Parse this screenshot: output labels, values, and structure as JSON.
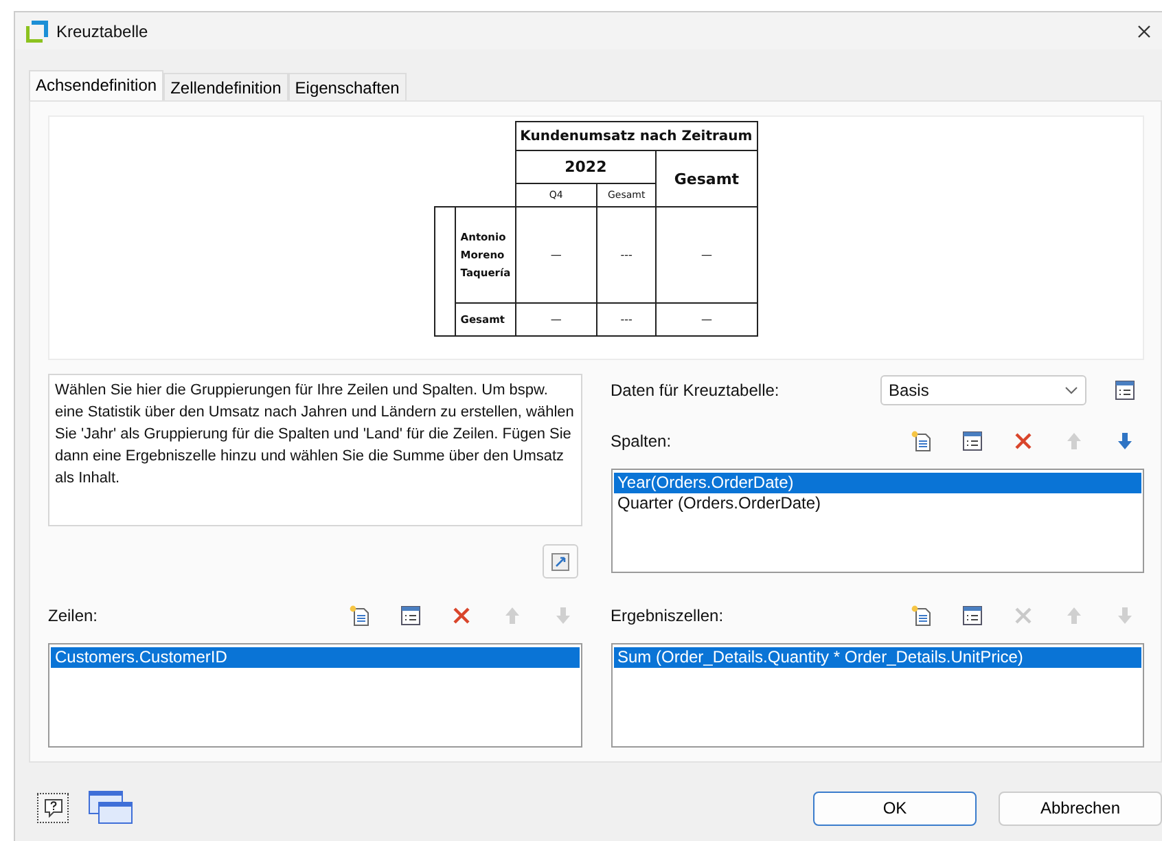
{
  "window": {
    "title": "Kreuztabelle"
  },
  "tabs": [
    {
      "label": "Achsendefinition",
      "selected": true
    },
    {
      "label": "Zellendefinition",
      "selected": false
    },
    {
      "label": "Eigenschaften",
      "selected": false
    }
  ],
  "preview": {
    "title": "Kundenumsatz nach Zeitraum",
    "column_group": "2022",
    "column_total": "Gesamt",
    "sub_columns": [
      "Q4",
      "Gesamt"
    ],
    "rows": [
      {
        "label": "Antonio Moreno Taquería",
        "cells": [
          "—",
          "---",
          "—"
        ]
      },
      {
        "label": "Gesamt",
        "cells": [
          "—",
          "---",
          "—"
        ]
      }
    ]
  },
  "description": "Wählen Sie hier die Gruppierungen für Ihre Zeilen und Spalten. Um bspw. eine Statistik über den Umsatz nach Jahren und Ländern zu erstellen, wählen Sie 'Jahr' als Gruppierung für die Spalten und 'Land' für die Zeilen. Fügen Sie dann eine Ergebniszelle hinzu und wählen Sie die Summe über den Umsatz als Inhalt.",
  "data_source": {
    "label": "Daten für Kreuztabelle:",
    "value": "Basis"
  },
  "columns": {
    "label": "Spalten:",
    "tools": [
      {
        "kind": "add",
        "disabled": false
      },
      {
        "kind": "properties",
        "disabled": false
      },
      {
        "kind": "delete",
        "disabled": false
      },
      {
        "kind": "up",
        "disabled": true
      },
      {
        "kind": "down",
        "disabled": false
      }
    ],
    "items": [
      {
        "text": "Year(Orders.OrderDate)",
        "selected": true
      },
      {
        "text": "Quarter (Orders.OrderDate)",
        "selected": false
      }
    ]
  },
  "rows": {
    "label": "Zeilen:",
    "tools": [
      {
        "kind": "add",
        "disabled": false
      },
      {
        "kind": "properties",
        "disabled": false
      },
      {
        "kind": "delete",
        "disabled": false
      },
      {
        "kind": "up",
        "disabled": true
      },
      {
        "kind": "down",
        "disabled": true
      }
    ],
    "items": [
      {
        "text": "Customers.CustomerID",
        "selected": true
      }
    ]
  },
  "result_cells": {
    "label": "Ergebniszellen:",
    "tools": [
      {
        "kind": "add",
        "disabled": false
      },
      {
        "kind": "properties",
        "disabled": false
      },
      {
        "kind": "delete",
        "disabled": true
      },
      {
        "kind": "up",
        "disabled": true
      },
      {
        "kind": "down",
        "disabled": true
      }
    ],
    "items": [
      {
        "text": "Sum (Order_Details.Quantity * Order_Details.UnitPrice)",
        "selected": true
      }
    ]
  },
  "buttons": [
    {
      "label": "OK",
      "kind": "default"
    },
    {
      "label": "Abbrechen",
      "kind": "normal"
    }
  ]
}
